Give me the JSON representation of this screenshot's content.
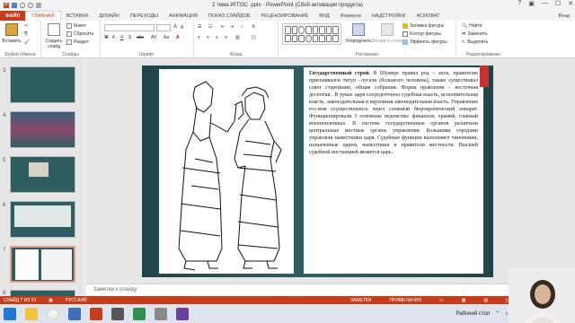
{
  "window": {
    "title": "2 тема ИГПЗС .pptx - PowerPoint (Сбой активации продукта)",
    "help": "?"
  },
  "tabs": [
    {
      "label": "ФАЙЛ"
    },
    {
      "label": "ГЛАВНАЯ"
    },
    {
      "label": "ВСТАВКА"
    },
    {
      "label": "ДИЗАЙН"
    },
    {
      "label": "ПЕРЕХОДЫ"
    },
    {
      "label": "АНИМАЦИЯ"
    },
    {
      "label": "ПОКАЗ СЛАЙДОВ"
    },
    {
      "label": "РЕЦЕНЗИРОВАНИЕ"
    },
    {
      "label": "ВИД"
    },
    {
      "label": "Формула"
    },
    {
      "label": "НАДСТРОЙКИ"
    },
    {
      "label": "ACROBAT"
    }
  ],
  "tabs_right": "Вход",
  "ribbon": {
    "clipboard": {
      "paste": "Вставить",
      "cut": "",
      "copy": "",
      "format": "",
      "label": "Буфер обмена"
    },
    "slides": {
      "new": "Создать слайд",
      "layout": "Макет",
      "reset": "Сбросить",
      "section": "Раздел",
      "label": "Слайды"
    },
    "font": {
      "label": "Шрифт"
    },
    "paragraph": {
      "label": "Абзац"
    },
    "drawing": {
      "arrange": "Упорядочить",
      "styles": "Экспресс-стили",
      "fill": "Заливка фигуры",
      "outline": "Контур фигуры",
      "effects": "Эффекты фигуры",
      "label": "Рисование"
    },
    "editing": {
      "find": "Найти",
      "replace": "Заменить",
      "select": "Выделить",
      "label": "Редактирование"
    }
  },
  "slide_numbers": [
    "3",
    "4",
    "5",
    "6",
    "7",
    "8"
  ],
  "slide": {
    "heading": "Государственный строй.",
    "body": " В Шумере правил род – энси, правителю присваивался титул –лугаля (большого человека), также существовал совет старейшин, общие собрания. Форма правления – восточная деспотия . В руках царя сосредоточена судебная власть, исполнительная власть, законодательная и верховная законодательная власть. Управление гос-вом осуществлялось через сложный бюрократический аппарат. Функционировали 3 основные ведомства: финансов, храмий, главный военнопленных. В системе государственных органов различали центральные местные органы управления. Большими городами управляли наместники царя. Судебные функции выполняют чиновники, назначенные царем, наместники и правители местности. Высшей судебной инстанцией является царь."
  },
  "notes": "Заметки к слайду",
  "status": {
    "slide": "СЛАЙД 7 ИЗ 23",
    "lang": "РУССКИЙ",
    "notes": "ЗАМЕТКИ",
    "comments": "ПРИМЕЧАНИЯ"
  },
  "tray": {
    "desktop": "Рабочий стол",
    "lang": "RU"
  }
}
